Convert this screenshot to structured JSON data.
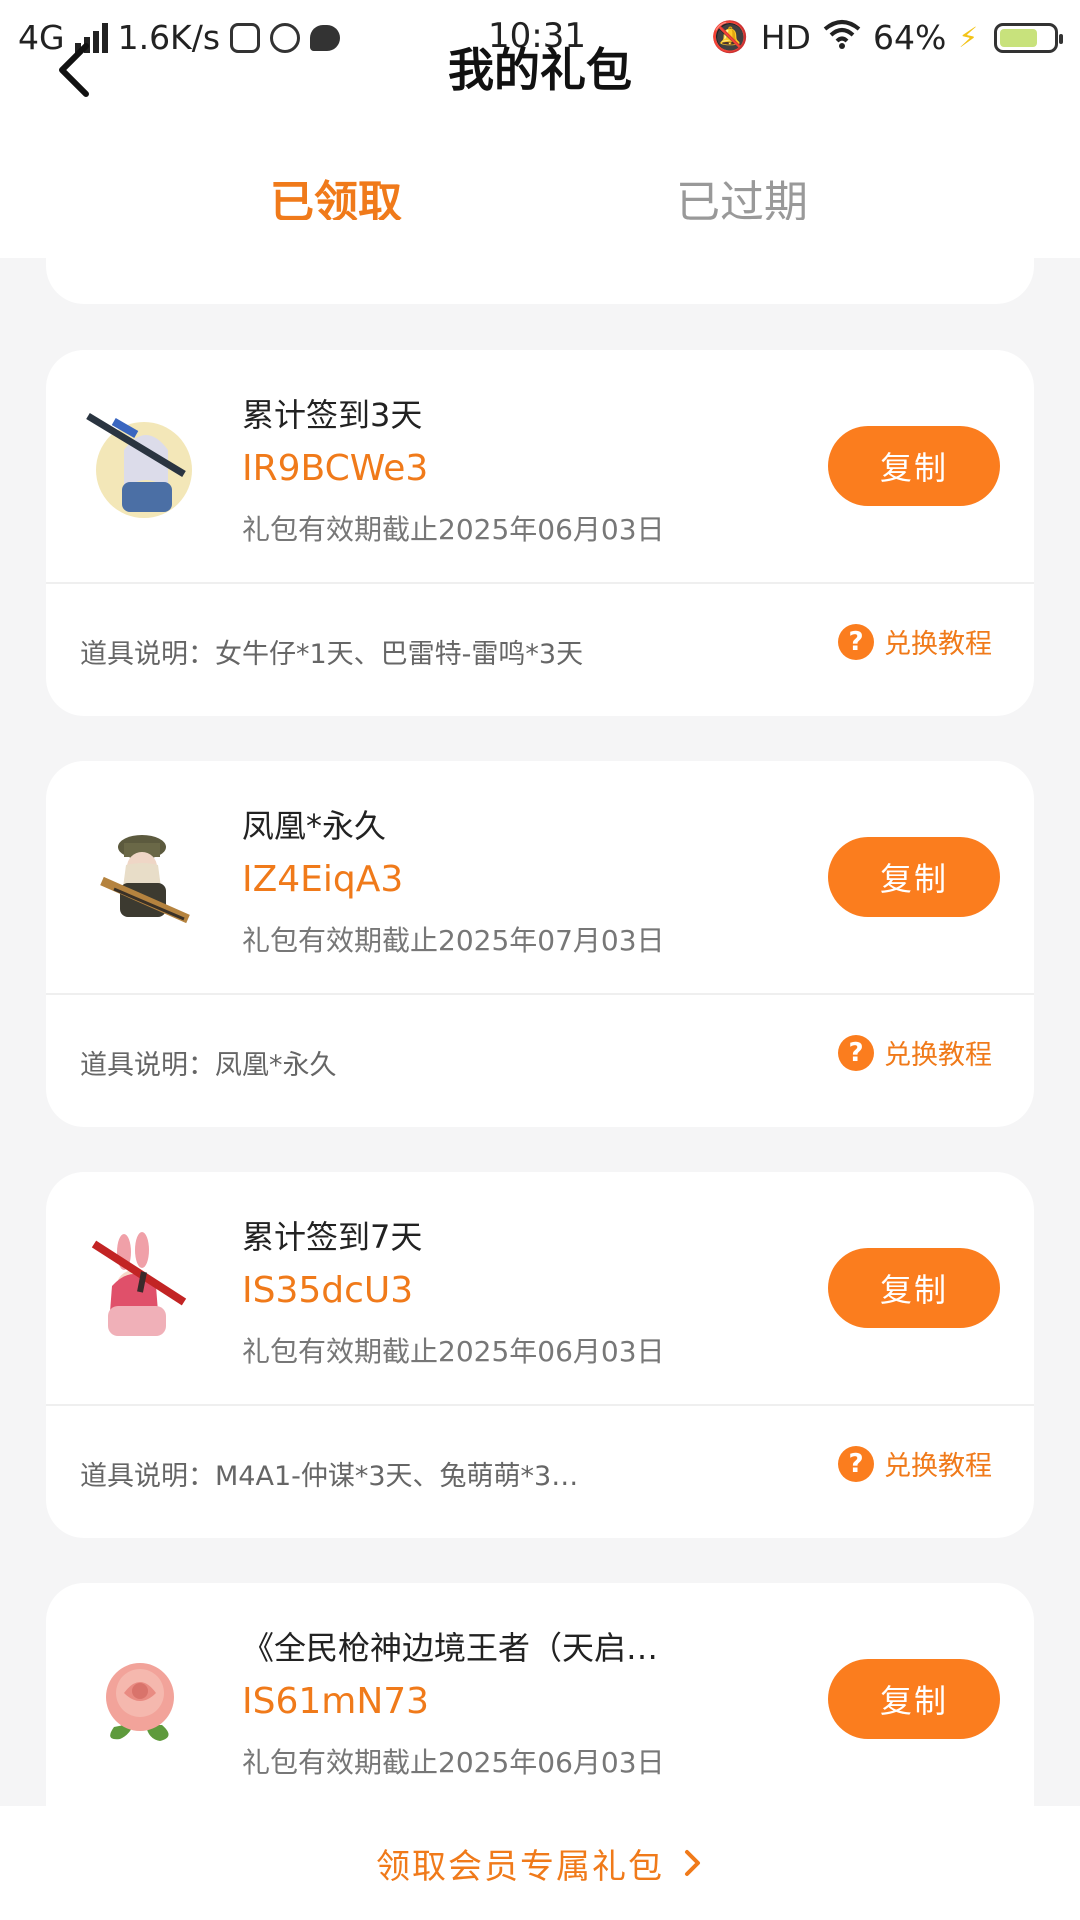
{
  "status_bar": {
    "network": "4G",
    "speed": "1.6K/s",
    "time": "10:31",
    "hd": "HD",
    "battery": "64%"
  },
  "header": {
    "title": "我的礼包",
    "tabs": [
      {
        "label": "已领取",
        "active": true
      },
      {
        "label": "已过期",
        "active": false
      }
    ]
  },
  "gifts": [
    {
      "title": "累计签到3天",
      "code": "IR9BCWe3",
      "expiry": "礼包有效期截止2025年06月03日",
      "copy_label": "复制",
      "items": "道具说明：女牛仔*1天、巴雷特-雷鸣*3天",
      "tutorial_label": "兑换教程",
      "icon": "character-with-sniper-rifle"
    },
    {
      "title": "凤凰*永久",
      "code": "IZ4EiqA3",
      "expiry": "礼包有效期截止2025年07月03日",
      "copy_label": "复制",
      "items": "道具说明：凤凰*永久",
      "tutorial_label": "兑换教程",
      "icon": "character-with-rifle"
    },
    {
      "title": "累计签到7天",
      "code": "IS35dcU3",
      "expiry": "礼包有效期截止2025年06月03日",
      "copy_label": "复制",
      "items": "道具说明：M4A1-仲谋*3天、兔萌萌*3…",
      "tutorial_label": "兑换教程",
      "icon": "bunny-character-with-rifle"
    },
    {
      "title": "《全民枪神边境王者（天启…",
      "code": "IS61mN73",
      "expiry": "礼包有效期截止2025年06月03日",
      "copy_label": "复制",
      "icon": "rose"
    }
  ],
  "bottom": {
    "member_link": "领取会员专属礼包"
  },
  "colors": {
    "accent": "#f07a1a",
    "button": "#fb7d1e",
    "background": "#f5f5f6"
  }
}
